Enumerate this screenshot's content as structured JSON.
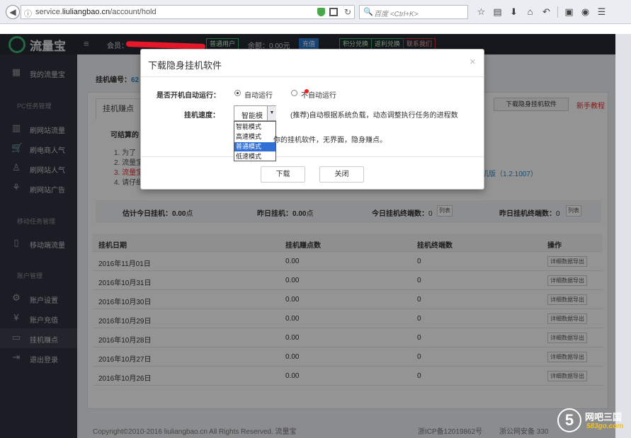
{
  "browser": {
    "url_prefix": "service.",
    "url_domain": "liuliangbao.cn",
    "url_path": "/account/hold",
    "search_placeholder": "百度 <Ctrl+K>"
  },
  "header": {
    "logo": "流量宝",
    "member_label": "会员：",
    "badge_normal": "普通用户",
    "balance_label": "余额：0.00元",
    "recharge": "充值",
    "btn1": "积分兑换",
    "btn2": "返利兑换",
    "btn3": "联系我们"
  },
  "sidebar": {
    "my_account": "我的流量宝",
    "section_pc": "PC任务管理",
    "items": [
      "刷网站流量",
      "刷电商人气",
      "刷网站人气",
      "刷网站广告"
    ],
    "section_mobile": "移动任务管理",
    "mobile": "移动端流量",
    "section_account": "账户管理",
    "account_items": [
      "账户设置",
      "账户充值",
      "挂机赚点",
      "退出登录"
    ]
  },
  "main": {
    "hold_label": "挂机编号：",
    "hold_id": "62",
    "tab": "挂机赚点",
    "download_soft": "下载隐身挂机软件",
    "newbie": "新手教程",
    "earn_prefix": "可结算的",
    "tips": [
      "1. 为了",
      "2. 流量宝",
      "3. 流量宝",
      "4. 请仔细"
    ],
    "tip_link": "机版（1.2.1007）",
    "stats": {
      "today_est_label": "估计今日挂机：",
      "today_est": "0.00",
      "unit": "点",
      "yesterday_label": "昨日挂机：",
      "yesterday": "0.00",
      "today_terminals_label": "今日挂机终端数：",
      "today_terminals": "0",
      "yesterday_terminals_label": "昨日挂机终端数：",
      "yesterday_terminals": "0",
      "list_btn": "列表"
    },
    "table": {
      "headers": [
        "挂机日期",
        "挂机赚点数",
        "挂机终端数",
        "操作"
      ],
      "rows": [
        {
          "date": "2016年11月01日",
          "points": "0.00",
          "terminals": "0"
        },
        {
          "date": "2016年10月31日",
          "points": "0.00",
          "terminals": "0"
        },
        {
          "date": "2016年10月30日",
          "points": "0.00",
          "terminals": "0"
        },
        {
          "date": "2016年10月29日",
          "points": "0.00",
          "terminals": "0"
        },
        {
          "date": "2016年10月28日",
          "points": "0.00",
          "terminals": "0"
        },
        {
          "date": "2016年10月27日",
          "points": "0.00",
          "terminals": "0"
        },
        {
          "date": "2016年10月26日",
          "points": "0.00",
          "terminals": "0"
        }
      ],
      "row_btn": "详细数据导出"
    },
    "footer": "Copyright©2010-2016 liuliangbao.cn All Rights Reserved. 流量宝",
    "icp": "浙ICP备12019862号",
    "police": "浙公网安备 330"
  },
  "watermark": {
    "digit": "5",
    "title": "网吧三国",
    "sub": "583go.com"
  },
  "modal": {
    "title": "下载隐身挂机软件",
    "close": "×",
    "auto_label": "是否开机自动运行：",
    "opt_auto": "自动运行",
    "opt_no_auto": "不自动运行",
    "speed_label": "挂机速度：",
    "speed_value": "智能模",
    "speed_note": "(推荐)自动根据系统负载，动态调整执行任务的进程数",
    "options": [
      "智能模式",
      "高速模式",
      "普通模式",
      "低速模式"
    ],
    "desc": "你的挂机软件，无界面，隐身赚点。",
    "download": "下载",
    "close_btn": "关闭"
  }
}
